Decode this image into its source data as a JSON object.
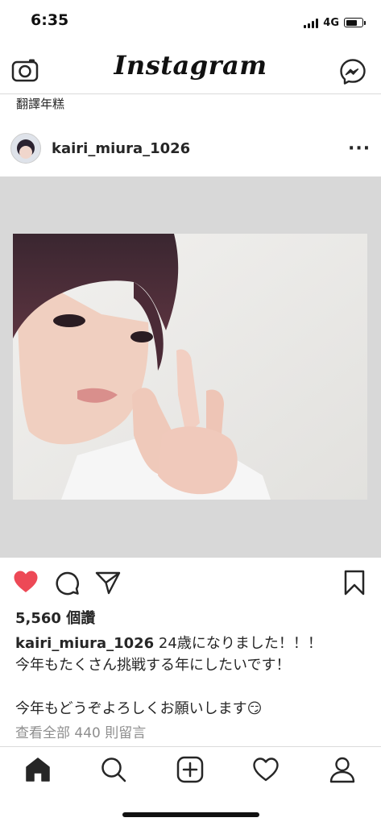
{
  "status_bar": {
    "time": "6:35",
    "network": "4G",
    "battery_level": 0.75
  },
  "header": {
    "logo": "Instagram",
    "left_icon": "camera-icon",
    "right_icon": "messenger-icon"
  },
  "translate_link": "翻譯年糕",
  "post": {
    "username": "kairi_miura_1026",
    "menu_icon": "more-options-icon",
    "liked": true,
    "likes_text": "5,560 個讚",
    "caption_username": "kairi_miura_1026",
    "caption_line1": " 24歳になりました！！！",
    "caption_line2": "今年もたくさん挑戦する年にしたいです！",
    "caption_line3": "今年もどうぞよろしくお願いします😏",
    "view_comments": "查看全部 440 則留言"
  },
  "tab_bar": {
    "items": [
      "home-icon",
      "search-icon",
      "new-post-icon",
      "activity-icon",
      "profile-icon"
    ],
    "active": "home-icon"
  },
  "colors": {
    "like": "#ed4956",
    "text": "#262626",
    "secondary": "#8e8e8e",
    "divider": "#dbdbdb"
  }
}
